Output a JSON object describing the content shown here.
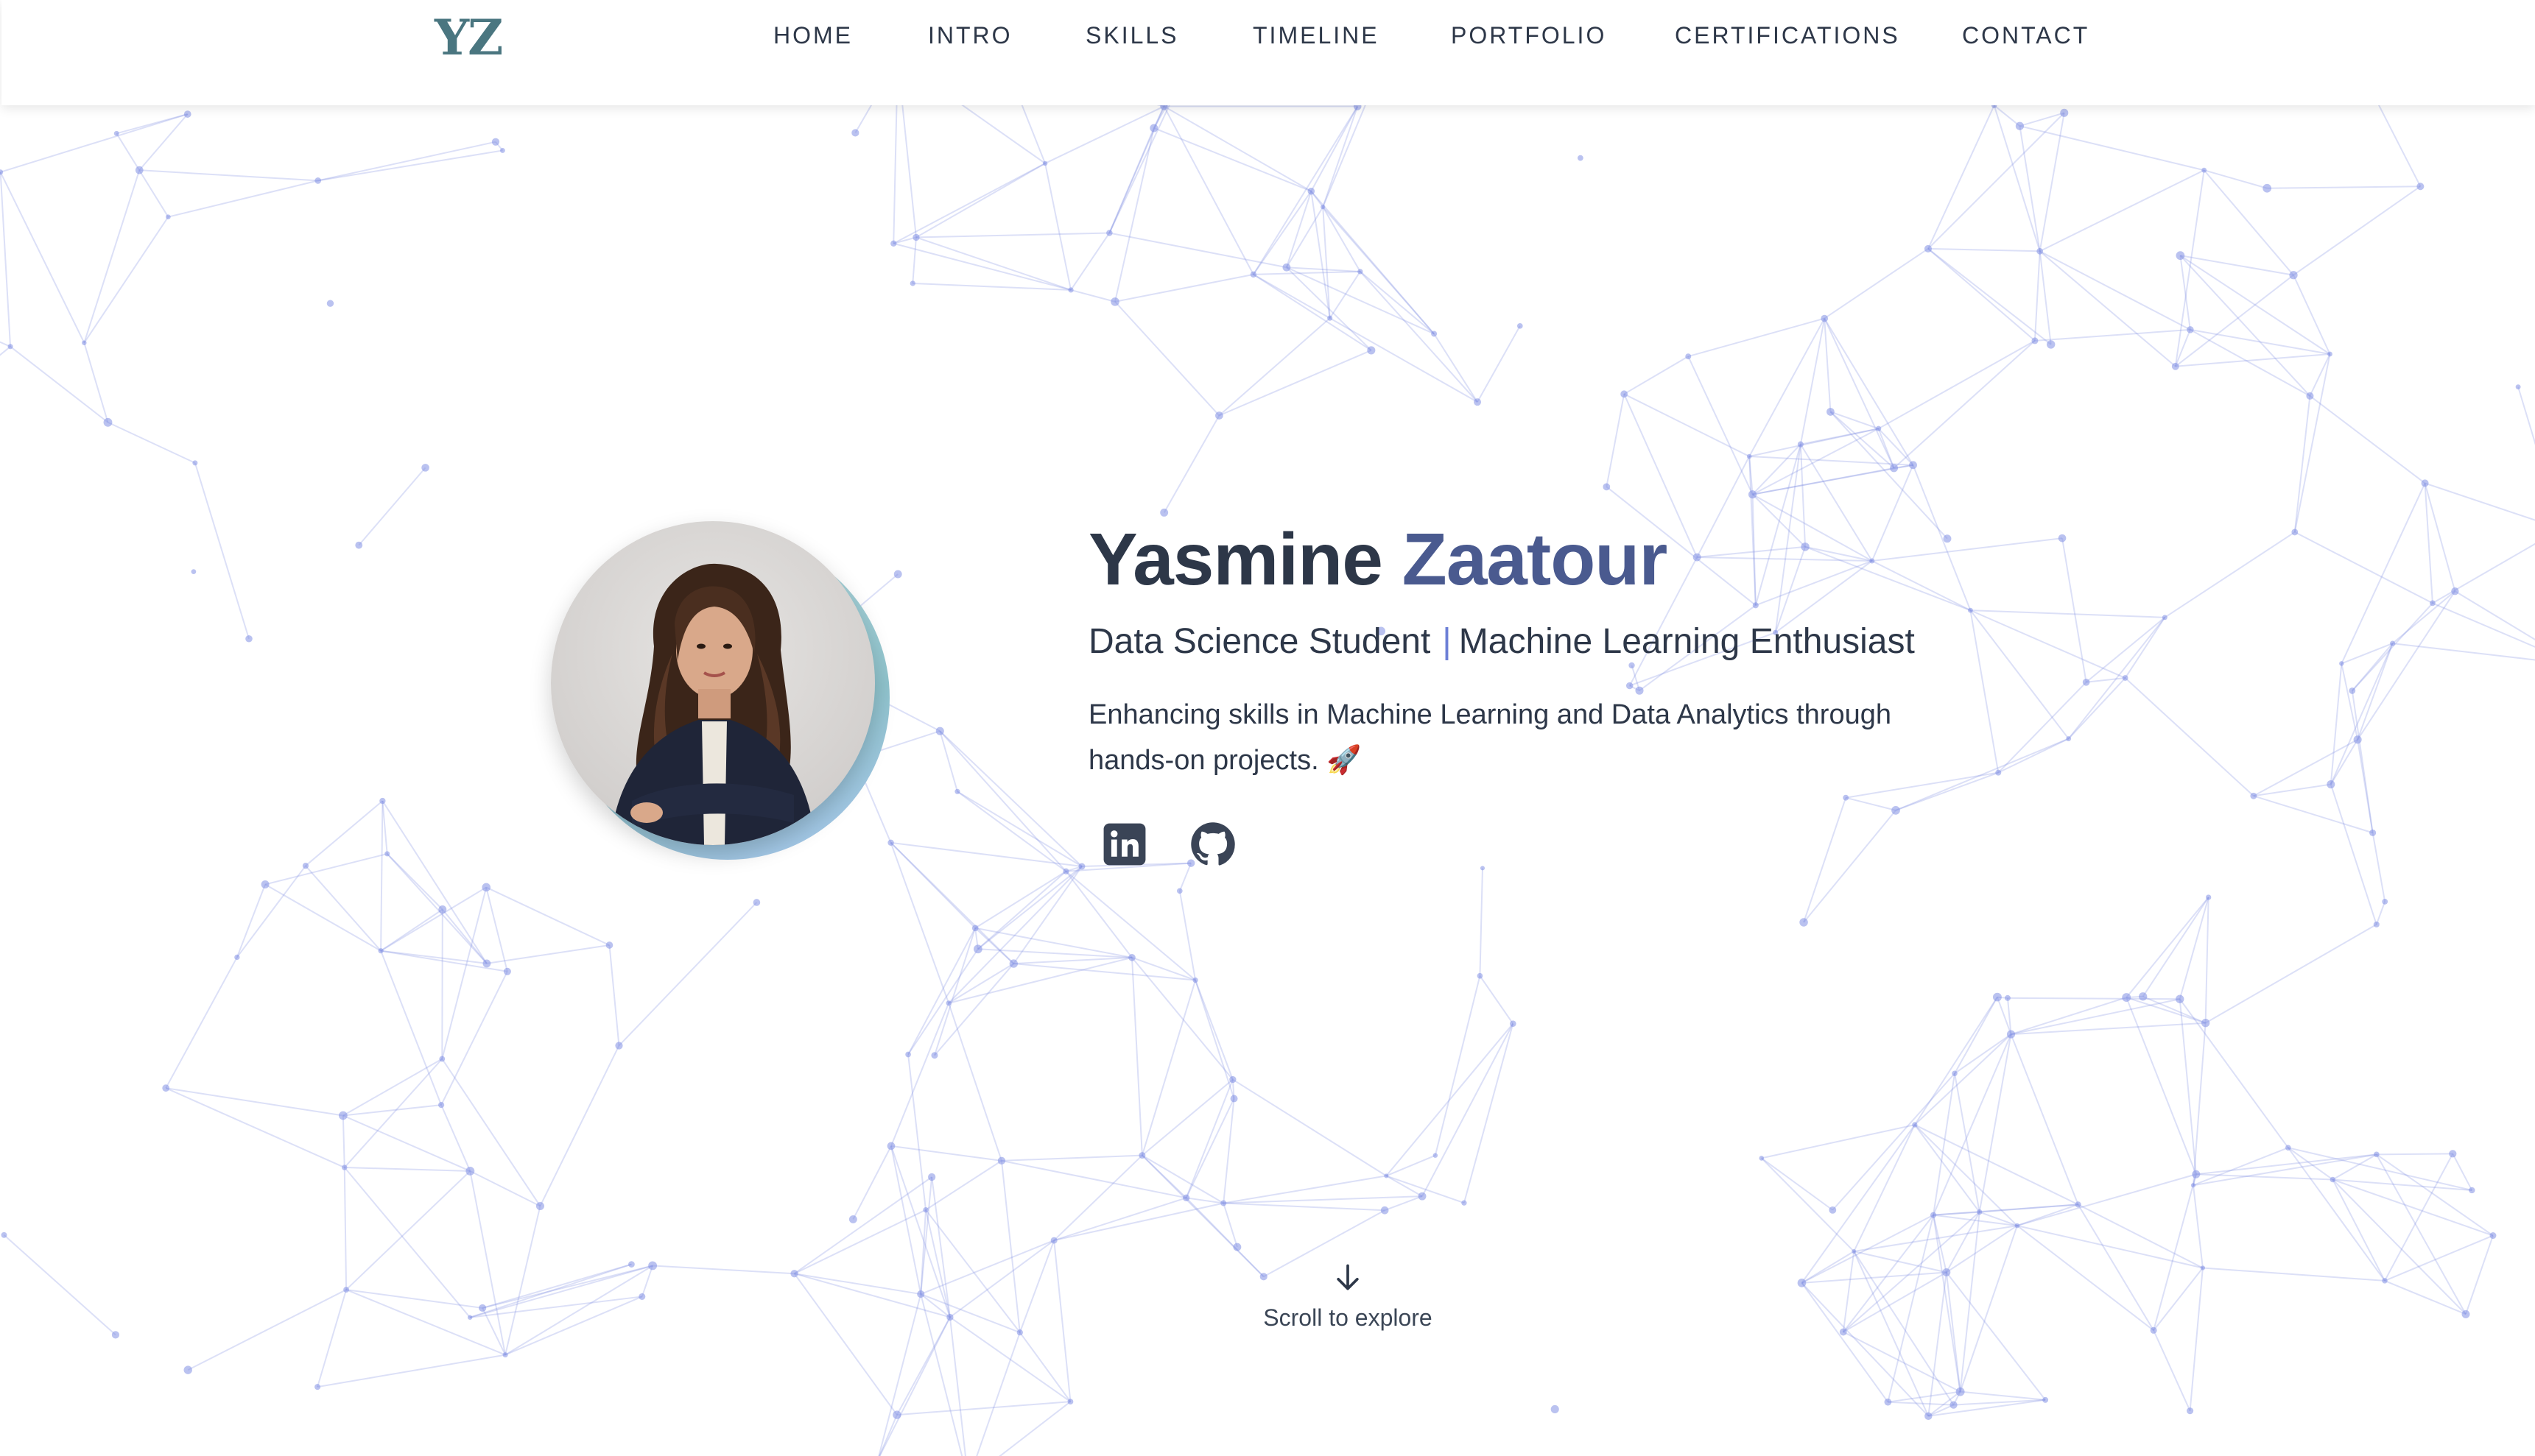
{
  "nav": {
    "logo": "YZ",
    "links": [
      {
        "label": "HOME"
      },
      {
        "label": "INTRO"
      },
      {
        "label": "SKILLS"
      },
      {
        "label": "TIMELINE"
      },
      {
        "label": "PORTFOLIO"
      },
      {
        "label": "CERTIFICATIONS"
      },
      {
        "label": "CONTACT"
      }
    ]
  },
  "hero": {
    "first_name": "Yasmine",
    "last_name": "Zaatour",
    "subtitle_left": "Data Science Student",
    "subtitle_divider": "|",
    "subtitle_right": "Machine Learning Enthusiast",
    "description": "Enhancing skills in Machine Learning and Data Analytics through hands-on projects. 🚀",
    "socials": [
      {
        "icon": "linkedin-icon"
      },
      {
        "icon": "github-icon"
      }
    ]
  },
  "scroll": {
    "label": "Scroll to explore",
    "icon": "arrow-down-icon"
  },
  "colors": {
    "accent": "#4a5a8f",
    "logo": "#4a7680",
    "network": "#8190e3",
    "text": "#2d3748"
  }
}
